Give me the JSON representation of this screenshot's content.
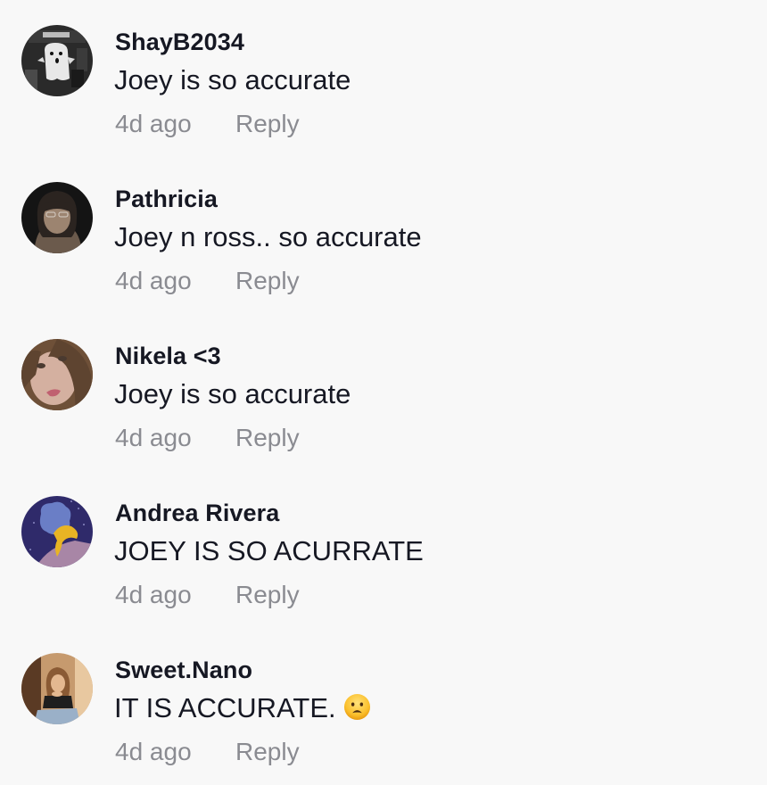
{
  "comments": [
    {
      "username": "ShayB2034",
      "text": "Joey is so accurate",
      "timestamp": "4d ago",
      "reply_label": "Reply",
      "avatar": "ghost-photo-avatar"
    },
    {
      "username": "Pathricia",
      "text": "Joey n ross.. so accurate",
      "timestamp": "4d ago",
      "reply_label": "Reply",
      "avatar": "person-photo-avatar"
    },
    {
      "username": "Nikela <3",
      "text": "Joey is so accurate",
      "timestamp": "4d ago",
      "reply_label": "Reply",
      "avatar": "selfie-photo-avatar"
    },
    {
      "username": "Andrea Rivera",
      "text": "JOEY IS SO ACURRATE",
      "timestamp": "4d ago",
      "reply_label": "Reply",
      "avatar": "cartoon-avatar"
    },
    {
      "username": "Sweet.Nano",
      "text": "IT IS ACCURATE.",
      "emoji": "frowning-face-open-mouth-emoji",
      "timestamp": "4d ago",
      "reply_label": "Reply",
      "avatar": "person-sitting-photo-avatar"
    }
  ],
  "colors": {
    "background": "#f8f8f8",
    "primary_text": "#161823",
    "secondary_text": "#8a8b91"
  }
}
